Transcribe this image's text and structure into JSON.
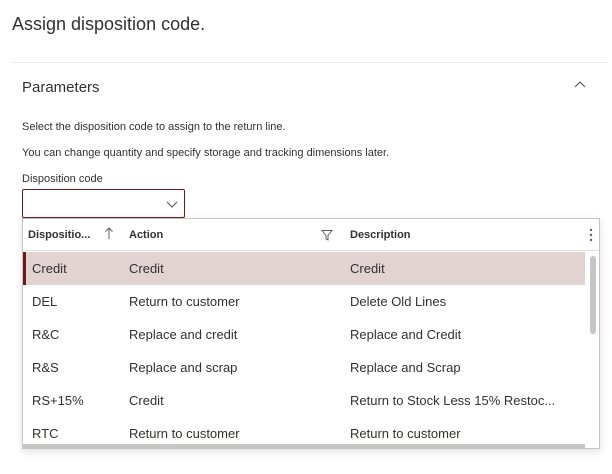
{
  "dialog": {
    "title": "Assign disposition code."
  },
  "parameters": {
    "title": "Parameters",
    "info_line_1": "Select the disposition code to assign to the return line.",
    "info_line_2": "You can change quantity and specify storage and tracking dimensions later.",
    "field_label": "Disposition code",
    "field_value": ""
  },
  "lookup": {
    "columns": {
      "code": "Dispositio...",
      "action": "Action",
      "description": "Description"
    },
    "rows": [
      {
        "code": "Credit",
        "action": "Credit",
        "description": "Credit",
        "selected": true
      },
      {
        "code": "DEL",
        "action": "Return to customer",
        "description": "Delete Old Lines"
      },
      {
        "code": "R&C",
        "action": "Replace and credit",
        "description": "Replace and Credit"
      },
      {
        "code": "R&S",
        "action": "Replace and scrap",
        "description": "Replace and Scrap"
      },
      {
        "code": "RS+15%",
        "action": "Credit",
        "description": "Return to Stock Less 15% Restoc..."
      },
      {
        "code": "RTC",
        "action": "Return to customer",
        "description": "Return to customer"
      }
    ]
  },
  "icons": {
    "collapse": "chevron-up-icon",
    "dropdown": "chevron-down-icon",
    "sort": "sort-ascending-icon",
    "filter": "filter-icon",
    "more": "more-vertical-icon"
  },
  "colors": {
    "accent": "#6b1a1a",
    "selected_row": "#e2d3d3"
  }
}
